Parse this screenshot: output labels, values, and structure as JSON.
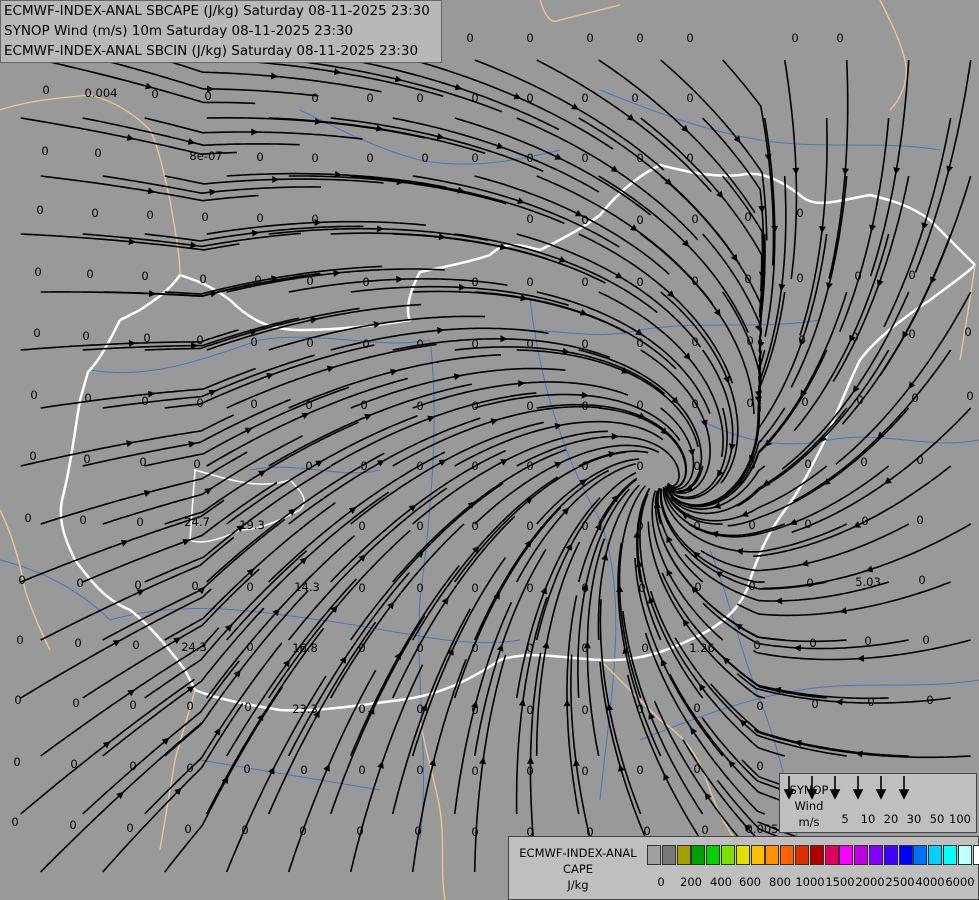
{
  "header": {
    "line1": "ECMWF-INDEX-ANAL SBCAPE (J/kg) Saturday 08-11-2025 23:30",
    "line2": "SYNOP Wind (m/s) 10m Saturday 08-11-2025 23:30",
    "line3": "ECMWF-INDEX-ANAL SBCIN (J/kg) Saturday 08-11-2025 23:30"
  },
  "colors": {
    "background": "#999999",
    "border_national": "#ffffff",
    "border_outer": "#e8c890",
    "rivers": "#3a70c8",
    "streamlines": "#000000"
  },
  "map_values": [
    "0",
    "0",
    "0",
    "0",
    "0",
    "0",
    "0",
    "0",
    "0",
    "0",
    "0",
    "0",
    "0",
    "0.004",
    "0",
    "0",
    "0",
    "0",
    "0",
    "0",
    "0",
    "0",
    "0",
    "0",
    "0",
    "0",
    "8e-07",
    "0",
    "0",
    "0",
    "0",
    "0",
    "0",
    "0",
    "0",
    "0",
    "24.7",
    "19.3",
    "14.3",
    "16.8",
    "24.3",
    "23.3",
    "1.26",
    "5.03",
    "0.005"
  ],
  "wind_legend": {
    "title_line1": "SYNOP",
    "title_line2": "Wind",
    "title_line3": "m/s",
    "values": [
      "5",
      "10",
      "20",
      "30",
      "50",
      "100"
    ]
  },
  "cape_legend": {
    "title_line1": "ECMWF-INDEX-ANAL",
    "title_line2": "CAPE",
    "title_line3": "J/kg",
    "colors": [
      "#a0a0a0",
      "#787878",
      "#a0a000",
      "#00a000",
      "#00d000",
      "#80e000",
      "#e0e000",
      "#ffc000",
      "#ff9000",
      "#ff6000",
      "#e03000",
      "#b00000",
      "#e00060",
      "#ff00ff",
      "#c000e0",
      "#8000ff",
      "#4000ff",
      "#0000ff",
      "#0070ff",
      "#00d0ff",
      "#00ffff",
      "#c0ffff",
      "#ffffff"
    ],
    "labels": [
      "0",
      "200",
      "400",
      "600",
      "800",
      "1000",
      "1500",
      "2000",
      "2500",
      "4000",
      "6000"
    ]
  }
}
